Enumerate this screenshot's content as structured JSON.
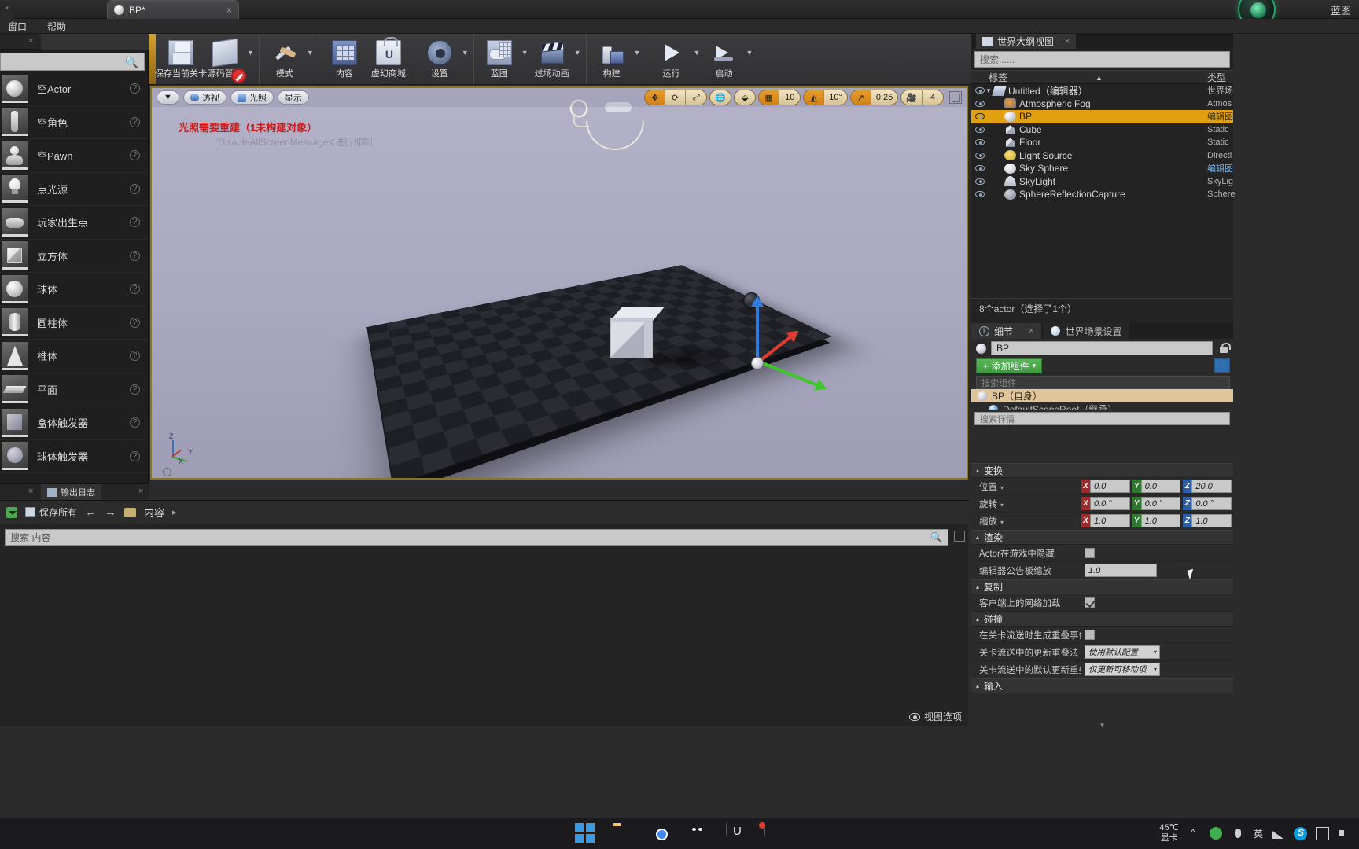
{
  "titlebar": {
    "tab_label": "BP*",
    "close_glyph": "×",
    "left_stub": "*",
    "app_title": "蓝图"
  },
  "menubar": {
    "items": [
      "窗口",
      "帮助"
    ]
  },
  "placement_panel": {
    "search_placeholder": "",
    "search_icon": "search-icon",
    "items": [
      {
        "label": "空Actor",
        "shape": "sphere"
      },
      {
        "label": "空角色",
        "shape": "person"
      },
      {
        "label": "空Pawn",
        "shape": "pawn"
      },
      {
        "label": "点光源",
        "shape": "bulb"
      },
      {
        "label": "玩家出生点",
        "shape": "pad"
      },
      {
        "label": "立方体",
        "shape": "cube"
      },
      {
        "label": "球体",
        "shape": "sphere"
      },
      {
        "label": "圆柱体",
        "shape": "cylinder"
      },
      {
        "label": "椎体",
        "shape": "cone"
      },
      {
        "label": "平面",
        "shape": "plane"
      },
      {
        "label": "盒体触发器",
        "shape": "boxtrigger"
      },
      {
        "label": "球体触发器",
        "shape": "spheretrigger"
      }
    ],
    "help_glyph": "?"
  },
  "output_log_tab": {
    "label": "输出日志",
    "close_glyph": "×"
  },
  "toolbar": {
    "buttons": [
      {
        "label": "保存当前关卡",
        "icon": "save-icon",
        "caret": false
      },
      {
        "label": "源码管理",
        "icon": "source-control-icon",
        "caret": true
      },
      {
        "label": "模式",
        "icon": "modes-icon",
        "caret": true
      },
      {
        "label": "内容",
        "icon": "content-icon",
        "caret": false
      },
      {
        "label": "虚幻商城",
        "icon": "marketplace-icon",
        "caret": false
      },
      {
        "label": "设置",
        "icon": "settings-icon",
        "caret": true
      },
      {
        "label": "蓝图",
        "icon": "blueprint-icon",
        "caret": true
      },
      {
        "label": "过场动画",
        "icon": "cinematics-icon",
        "caret": true
      },
      {
        "label": "构建",
        "icon": "build-icon",
        "caret": true
      },
      {
        "label": "运行",
        "icon": "play-icon",
        "caret": true
      },
      {
        "label": "启动",
        "icon": "launch-icon",
        "caret": true
      }
    ]
  },
  "viewport": {
    "left_buttons": [
      {
        "label": "",
        "icon": "chevron-down-icon"
      },
      {
        "label": "透视",
        "icon": "perspective-icon"
      },
      {
        "label": "光照",
        "icon": "lit-icon"
      },
      {
        "label": "显示",
        "icon": "show-icon"
      }
    ],
    "warning_line1": "光照需要重建（1未构建对象）",
    "warning_line2": "'DisableAllScreenMessages'进行抑制",
    "gizmo_buttons": [
      {
        "icon": "translate-gizmo-icon",
        "active": true
      },
      {
        "icon": "rotate-gizmo-icon",
        "active": false
      },
      {
        "icon": "scale-gizmo-icon",
        "active": false
      }
    ],
    "coord_button": {
      "icon": "world-coords-icon"
    },
    "surface_snap": {
      "icon": "surface-snap-icon"
    },
    "grid_snap": {
      "icon": "grid-snap-icon",
      "value": "10",
      "enabled": true
    },
    "angle_snap": {
      "icon": "angle-snap-icon",
      "value": "10°",
      "enabled": true
    },
    "scale_snap": {
      "icon": "scale-snap-icon",
      "value": "0.25",
      "enabled": true
    },
    "camera_speed": {
      "icon": "camera-speed-icon",
      "value": "4"
    },
    "maximize_icon": "maximize-viewport-icon",
    "axis_labels": {
      "z": "Z",
      "y": "Y",
      "x": "X"
    }
  },
  "content_browser": {
    "save_all_label": "保存所有",
    "back_icon": "back-arrow-icon",
    "forward_icon": "forward-arrow-icon",
    "breadcrumb": "内容",
    "breadcrumb_sep": "▸",
    "search_placeholder": "搜索 内容",
    "search_icon": "search-icon",
    "view_options_label": "视图选项",
    "view_options_icon": "eye-icon"
  },
  "outliner": {
    "tab_label": "世界大纲视图",
    "tab_icon": "outliner-icon",
    "close_glyph": "×",
    "search_placeholder": "搜索......",
    "columns": {
      "label": "标签",
      "type": "类型"
    },
    "sort_caret": "▲",
    "rows": [
      {
        "name": "Untitled（编辑器）",
        "type": "世界场",
        "icon": "world-icon",
        "indent": 0,
        "expander": "▼",
        "selected": false,
        "type_link": false
      },
      {
        "name": "Atmospheric Fog",
        "type": "Atmos",
        "icon": "fog-icon",
        "indent": 1,
        "expander": "",
        "selected": false,
        "type_link": false
      },
      {
        "name": "BP",
        "type": "编辑图",
        "icon": "blueprint-actor-icon",
        "indent": 1,
        "expander": "",
        "selected": true,
        "type_link": false
      },
      {
        "name": "Cube",
        "type": "Static",
        "icon": "static-mesh-icon",
        "indent": 1,
        "expander": "",
        "selected": false,
        "type_link": false
      },
      {
        "name": "Floor",
        "type": "Static",
        "icon": "static-mesh-icon",
        "indent": 1,
        "expander": "",
        "selected": false,
        "type_link": false
      },
      {
        "name": "Light Source",
        "type": "Directi",
        "icon": "light-icon",
        "indent": 1,
        "expander": "",
        "selected": false,
        "type_link": false
      },
      {
        "name": "Sky Sphere",
        "type": "编辑图",
        "icon": "sky-sphere-icon",
        "indent": 1,
        "expander": "",
        "selected": false,
        "type_link": true
      },
      {
        "name": "SkyLight",
        "type": "SkyLig",
        "icon": "skylight-icon",
        "indent": 1,
        "expander": "",
        "selected": false,
        "type_link": false
      },
      {
        "name": "SphereReflectionCapture",
        "type": "Sphere",
        "icon": "reflection-capture-icon",
        "indent": 1,
        "expander": "",
        "selected": false,
        "type_link": false
      }
    ],
    "footer": "8个actor（选择了1个）"
  },
  "details": {
    "tabs": [
      {
        "label": "细节",
        "icon": "details-icon",
        "active": true,
        "close_glyph": "×"
      },
      {
        "label": "世界场景设置",
        "icon": "world-settings-icon",
        "active": false,
        "close_glyph": ""
      }
    ],
    "actor_name": "BP",
    "lock_icon": "lock-icon",
    "add_component_label": "添加组件",
    "add_component_plus": "+",
    "add_component_caret": "▾",
    "blueprint_button_icon": "edit-blueprint-icon",
    "component_search_placeholder": "搜索组件",
    "components": [
      {
        "label": "BP（自身）",
        "selected": true
      },
      {
        "label": "DefaultSceneRoot（继承）",
        "selected": false
      }
    ],
    "details_search_placeholder": "搜索详情",
    "sections": [
      {
        "title": "变换",
        "caret": "▴",
        "rows": [
          {
            "label": "位置",
            "caret": "▾",
            "kind": "xyz",
            "values": [
              "0.0",
              "0.0",
              "20.0"
            ]
          },
          {
            "label": "旋转",
            "caret": "▾",
            "kind": "xyz",
            "values": [
              "0.0 °",
              "0.0 °",
              "0.0 °"
            ]
          },
          {
            "label": "缩放",
            "caret": "▾",
            "kind": "xyz",
            "values": [
              "1.0",
              "1.0",
              "1.0"
            ]
          }
        ]
      },
      {
        "title": "渲染",
        "caret": "▴",
        "rows": [
          {
            "label": "Actor在游戏中隐藏",
            "caret": "",
            "kind": "checkbox",
            "checked": false
          },
          {
            "label": "编辑器公告板缩放",
            "caret": "",
            "kind": "number",
            "value": "1.0"
          }
        ]
      },
      {
        "title": "复制",
        "caret": "▴",
        "rows": [
          {
            "label": "客户端上的网络加载",
            "caret": "",
            "kind": "checkbox",
            "checked": true
          }
        ]
      },
      {
        "title": "碰撞",
        "caret": "▴",
        "rows": [
          {
            "label": "在关卡流送时生成重叠事件",
            "caret": "",
            "kind": "checkbox",
            "checked": false
          },
          {
            "label": "关卡流送中的更新重叠法",
            "caret": "",
            "kind": "dropdown",
            "value": "使用默认配置"
          },
          {
            "label": "关卡流送中的默认更新重叠法",
            "caret": "",
            "kind": "dropdown",
            "value": "仅更新可移动项"
          }
        ]
      },
      {
        "title": "输入",
        "caret": "▴",
        "rows": []
      }
    ],
    "expander_glyph": "▾"
  },
  "taskbar": {
    "apps": [
      {
        "icon": "windows-start-icon",
        "name": "start"
      },
      {
        "icon": "file-explorer-icon",
        "name": "explorer"
      },
      {
        "icon": "chrome-icon",
        "name": "chrome"
      },
      {
        "icon": "wechat-icon",
        "name": "wechat"
      },
      {
        "icon": "unreal-engine-icon",
        "name": "unreal"
      },
      {
        "icon": "app-icon",
        "name": "app"
      }
    ],
    "temperature": "45℃",
    "temperature_label": "显卡",
    "caret_icon": "chevron-up-icon",
    "ime_label": "英",
    "tray_icons": [
      "green-circle-icon",
      "mic-icon",
      "network-icon",
      "skype-icon",
      "display-icon",
      "volume-icon"
    ]
  }
}
